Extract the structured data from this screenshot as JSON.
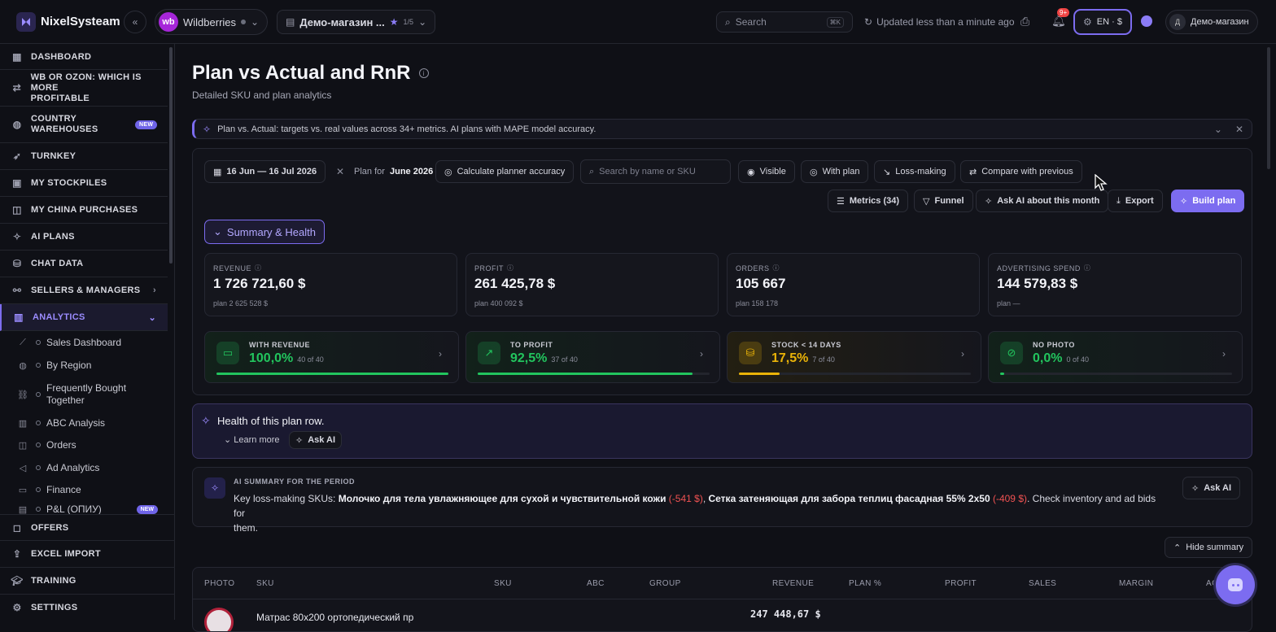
{
  "app": {
    "name": "NixelSysteam"
  },
  "topbar": {
    "marketplace": "Wildberries",
    "marketplace_logo": "wb",
    "store": "Демо-магазин ...",
    "store_count": "1/5",
    "search_placeholder": "Search",
    "search_shortcut": "⌘K",
    "updated": "Updated less than a minute ago",
    "notifications": "9+",
    "lang": "EN · $",
    "user_initial": "Д",
    "user": "Демо-магазин"
  },
  "sidebar": {
    "items": [
      {
        "label": "DASHBOARD",
        "icon": "grid-icon"
      },
      {
        "label": "WB OR OZON: WHICH IS MORE",
        "label2": "PROFITABLE",
        "icon": "compare-icon"
      },
      {
        "label": "COUNTRY",
        "label2": "WAREHOUSES",
        "badge": "NEW",
        "icon": "globe-icon"
      },
      {
        "label": "TURNKEY",
        "icon": "rocket-icon"
      },
      {
        "label": "MY STOCKPILES",
        "icon": "box-icon"
      },
      {
        "label": "MY CHINA PURCHASES",
        "icon": "bag-icon"
      },
      {
        "label": "AI PLANS",
        "icon": "sparkle-icon"
      },
      {
        "label": "CHAT DATA",
        "icon": "database-icon"
      },
      {
        "label": "SELLERS & MANAGERS",
        "icon": "handshake-icon"
      },
      {
        "label": "ANALYTICS",
        "icon": "chart-icon"
      }
    ],
    "analytics_sub": [
      {
        "label": "Sales Dashboard",
        "icon": "line-chart-icon"
      },
      {
        "label": "By Region",
        "icon": "globe-icon"
      },
      {
        "label": "Frequently Bought",
        "label2": "Together",
        "icon": "link-icon"
      },
      {
        "label": "ABC Analysis",
        "icon": "bar-chart-icon"
      },
      {
        "label": "Orders",
        "icon": "bag-icon"
      },
      {
        "label": "Ad Analytics",
        "icon": "megaphone-icon"
      },
      {
        "label": "Finance",
        "icon": "wallet-icon"
      },
      {
        "label": "P&L (ОПИУ)",
        "badge": "NEW",
        "icon": "report-icon"
      }
    ],
    "bottom": [
      {
        "label": "OFFERS",
        "icon": "chat-icon"
      },
      {
        "label": "EXCEL IMPORT",
        "icon": "upload-icon"
      },
      {
        "label": "TRAINING",
        "icon": "graduation-icon"
      },
      {
        "label": "SETTINGS",
        "icon": "gear-icon"
      }
    ]
  },
  "page": {
    "title": "Plan vs Actual and RnR",
    "subtitle": "Detailed SKU and plan analytics",
    "banner": "Plan vs. Actual: targets vs. real values across 34+ metrics. AI plans with MAPE model accuracy."
  },
  "filters": {
    "date": "16 Jun — 16 Jul 2026",
    "plan_for": "Plan for",
    "plan_month": "June 2026",
    "calc": "Calculate planner accuracy",
    "search_placeholder": "Search by name or SKU",
    "visible": "Visible",
    "with_plan": "With plan",
    "loss": "Loss-making",
    "compare": "Compare with previous",
    "metrics": "Metrics (34)",
    "funnel": "Funnel",
    "ask_ai_month": "Ask AI about this month",
    "export": "Export",
    "build": "Build plan",
    "summary_tab": "Summary & Health"
  },
  "kpis": [
    {
      "label": "REVENUE",
      "value": "1 726 721,60 $",
      "plan": "plan 2 625 528 $"
    },
    {
      "label": "PROFIT",
      "value": "261 425,78 $",
      "plan": "plan 400 092 $"
    },
    {
      "label": "ORDERS",
      "value": "105 667",
      "plan": "plan 158 178"
    },
    {
      "label": "ADVERTISING SPEND",
      "value": "144 579,83 $",
      "plan": "plan —"
    }
  ],
  "health": [
    {
      "label": "WITH REVENUE",
      "value": "100,0%",
      "count": "40 of 40",
      "pct": 1.0,
      "color": "#22c55e",
      "icon": "wallet-icon"
    },
    {
      "label": "TO PROFIT",
      "value": "92,5%",
      "count": "37 of 40",
      "pct": 0.925,
      "color": "#22c55e",
      "icon": "trend-up-icon"
    },
    {
      "label": "STOCK < 14 DAYS",
      "value": "17,5%",
      "count": "7 of 40",
      "pct": 0.175,
      "color": "#eab308",
      "icon": "stack-icon"
    },
    {
      "label": "NO PHOTO",
      "value": "0,0%",
      "count": "0 of 40",
      "pct": 0.0,
      "color": "#22c55e",
      "icon": "no-image-icon"
    }
  ],
  "health_row": {
    "title": "Health of this plan row.",
    "learn": "Learn more",
    "ask": "Ask AI"
  },
  "ai_summary": {
    "label": "AI SUMMARY FOR THE PERIOD",
    "prefix": "Key loss-making SKUs: ",
    "sku1": "Молочко для тела увлажняющее для сухой и чувствительной кожи",
    "val1": "(-541 $)",
    "sep": ", ",
    "sku2": "Сетка затеняющая для забора теплиц фасадная 55% 2х50",
    "val2": "(-409 $)",
    "suffix": ". Check inventory and ad bids for",
    "suffix2": "them.",
    "ask": "Ask AI",
    "hide": "Hide summary"
  },
  "table": {
    "headers": [
      "PHOTO",
      "SKU",
      "SKU",
      "ABC",
      "GROUP",
      "REVENUE",
      "PLAN %",
      "PROFIT",
      "SALES",
      "MARGIN",
      "ACT"
    ],
    "row1_name": "Матрас 80х200 ортопедический пр",
    "row1_revenue": "247 448,67 $"
  }
}
